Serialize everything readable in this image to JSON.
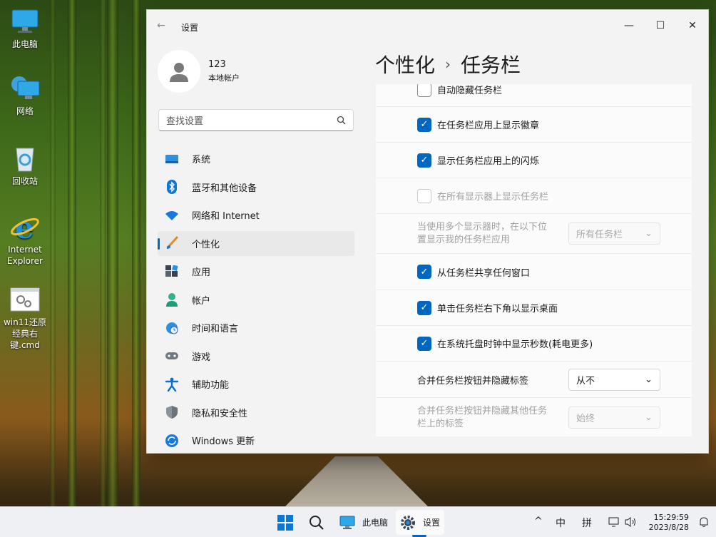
{
  "desktop": {
    "icons": [
      {
        "label": "此电脑",
        "icon": "monitor-icon"
      },
      {
        "label": "网络",
        "icon": "network-icon"
      },
      {
        "label": "回收站",
        "icon": "recycle-bin-icon"
      },
      {
        "label": "Internet Explorer",
        "icon": "ie-icon"
      },
      {
        "label": "win11还原经典右键.cmd",
        "icon": "cmd-file-icon"
      }
    ]
  },
  "window": {
    "app_title": "设置",
    "back_glyph": "←",
    "controls": {
      "minimize": "—",
      "maximize": "☐",
      "close": "✕"
    }
  },
  "profile": {
    "name": "123",
    "account_type": "本地帐户"
  },
  "search": {
    "placeholder": "查找设置",
    "icon": "search-icon"
  },
  "nav": {
    "items": [
      {
        "label": "系统",
        "icon": "system-icon"
      },
      {
        "label": "蓝牙和其他设备",
        "icon": "bluetooth-icon"
      },
      {
        "label": "网络和 Internet",
        "icon": "wifi-icon"
      },
      {
        "label": "个性化",
        "icon": "brush-icon",
        "active": true
      },
      {
        "label": "应用",
        "icon": "apps-icon"
      },
      {
        "label": "帐户",
        "icon": "account-icon"
      },
      {
        "label": "时间和语言",
        "icon": "time-language-icon"
      },
      {
        "label": "游戏",
        "icon": "gamepad-icon"
      },
      {
        "label": "辅助功能",
        "icon": "accessibility-icon"
      },
      {
        "label": "隐私和安全性",
        "icon": "shield-icon"
      },
      {
        "label": "Windows 更新",
        "icon": "update-icon"
      }
    ]
  },
  "header": {
    "crumb_parent": "个性化",
    "separator": "›",
    "crumb_current": "任务栏"
  },
  "settings": {
    "auto_hide": {
      "label": "自动隐藏任务栏",
      "checked": false
    },
    "badges": {
      "label": "在任务栏应用上显示徽章",
      "checked": true
    },
    "flashing": {
      "label": "显示任务栏应用上的闪烁",
      "checked": true
    },
    "all_displays": {
      "label": "在所有显示器上显示任务栏",
      "checked": false,
      "disabled": true
    },
    "multi_display": {
      "label_line1": "当使用多个显示器时，在以下位",
      "label_line2": "置显示我的任务栏应用",
      "value": "所有任务栏",
      "disabled": true
    },
    "share_window": {
      "label": "从任务栏共享任何窗口",
      "checked": true
    },
    "corner_desktop": {
      "label": "单击任务栏右下角以显示桌面",
      "checked": true
    },
    "seconds": {
      "label": "在系统托盘时钟中显示秒数(耗电更多)",
      "checked": true
    },
    "combine": {
      "label": "合并任务栏按钮并隐藏标签",
      "value": "从不"
    },
    "combine_other": {
      "label_line1": "合并任务栏按钮并隐藏其他任务",
      "label_line2": "栏上的标签",
      "value": "始终",
      "disabled": true
    }
  },
  "taskbar": {
    "start_icon": "windows-start-icon",
    "pc_label": "此电脑",
    "settings_label": "设置",
    "tray": {
      "chevron": "^",
      "ime_mode": "中",
      "ime": "拼"
    },
    "time": "15:29:59",
    "date": "2023/8/28"
  },
  "colors": {
    "accent": "#0067c0",
    "window_bg": "#f3f3f3",
    "card_bg": "#fbfbfb"
  }
}
